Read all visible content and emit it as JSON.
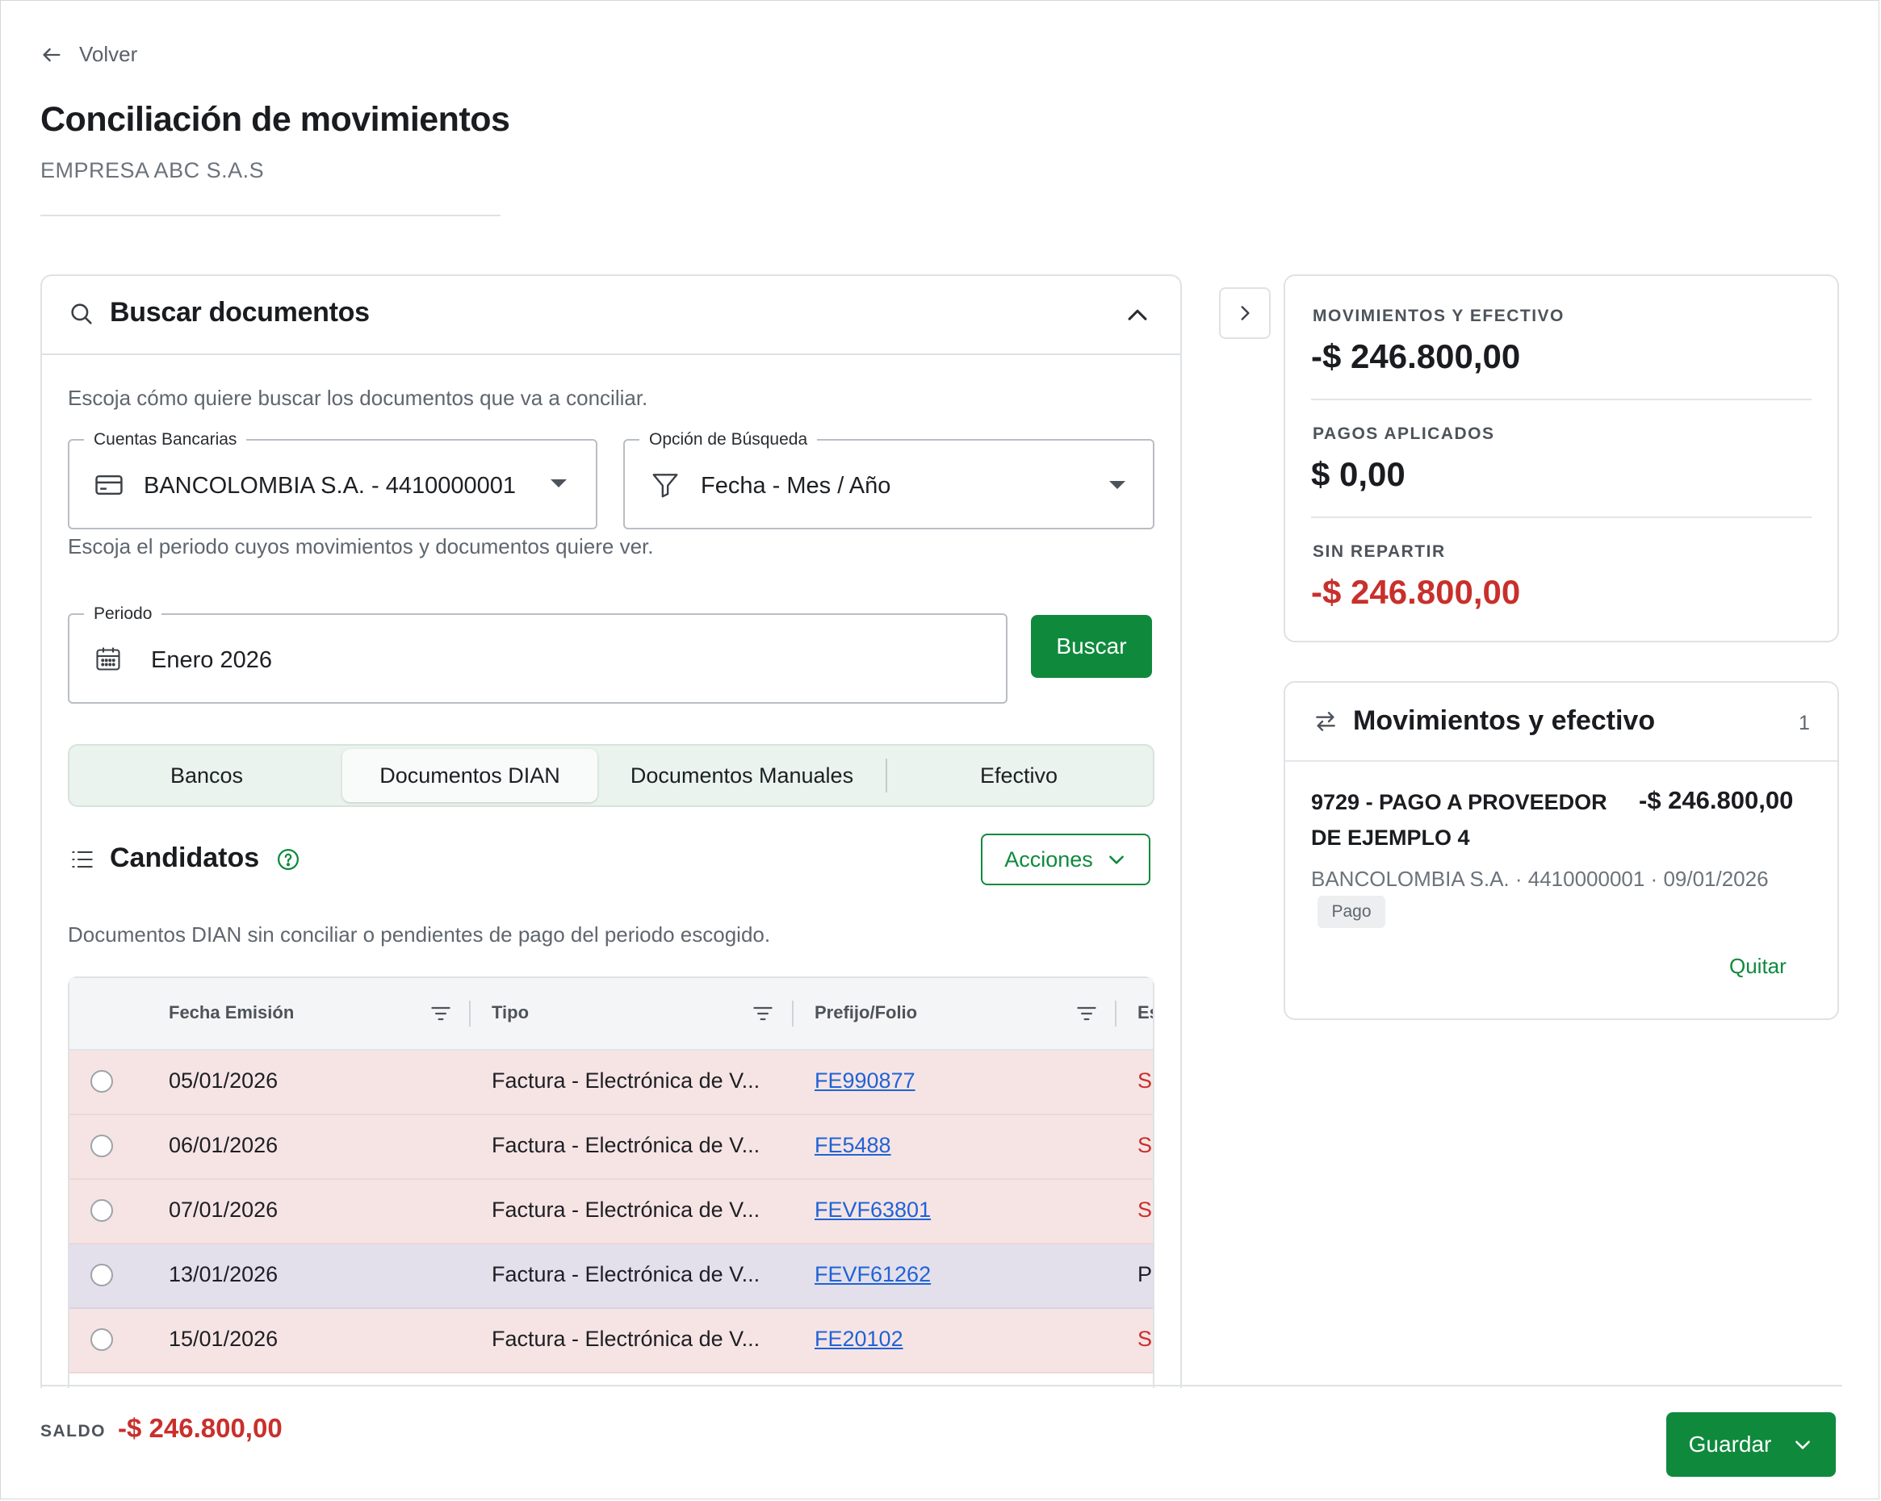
{
  "header": {
    "back_label": "Volver",
    "title": "Conciliación de movimientos",
    "subtitle": "EMPRESA ABC S.A.S"
  },
  "search": {
    "title": "Buscar documentos",
    "hint": "Escoja cómo quiere buscar los documentos que va a conciliar.",
    "bank_account": {
      "label": "Cuentas Bancarias",
      "value": "BANCOLOMBIA S.A. - 4410000001"
    },
    "search_option": {
      "label": "Opción de Búsqueda",
      "value": "Fecha - Mes / Año"
    },
    "period_hint": "Escoja el periodo cuyos movimientos y documentos quiere ver.",
    "period": {
      "label": "Periodo",
      "value": "Enero 2026"
    },
    "search_button": "Buscar"
  },
  "tabs": [
    {
      "label": "Bancos",
      "active": false
    },
    {
      "label": "Documentos DIAN",
      "active": true
    },
    {
      "label": "Documentos Manuales",
      "active": false
    },
    {
      "label": "Efectivo",
      "active": false
    }
  ],
  "candidates": {
    "title": "Candidatos",
    "actions_label": "Acciones",
    "description": "Documentos DIAN sin conciliar o pendientes de pago del periodo escogido.",
    "columns": [
      "Fecha Emisión",
      "Tipo",
      "Prefijo/Folio",
      "Es"
    ],
    "rows": [
      {
        "date": "05/01/2026",
        "type": "Factura - Electrónica de V...",
        "folio": "FE990877",
        "status": "S"
      },
      {
        "date": "06/01/2026",
        "type": "Factura - Electrónica de V...",
        "folio": "FE5488",
        "status": "S"
      },
      {
        "date": "07/01/2026",
        "type": "Factura - Electrónica de V...",
        "folio": "FEVF63801",
        "status": "S"
      },
      {
        "date": "13/01/2026",
        "type": "Factura - Electrónica de V...",
        "folio": "FEVF61262",
        "status": "P"
      },
      {
        "date": "15/01/2026",
        "type": "Factura - Electrónica de V...",
        "folio": "FE20102",
        "status": "S"
      }
    ]
  },
  "summary": {
    "movements_label": "MOVIMIENTOS Y EFECTIVO",
    "movements_value": "-$ 246.800,00",
    "applied_label": "PAGOS APLICADOS",
    "applied_value": "$ 0,00",
    "unallocated_label": "SIN REPARTIR",
    "unallocated_value": "-$ 246.800,00"
  },
  "movements": {
    "title": "Movimientos y efectivo",
    "count": "1",
    "item": {
      "name": "9729 - PAGO A PROVEEDOR DE EJEMPLO 4",
      "amount": "-$ 246.800,00",
      "meta": "BANCOLOMBIA S.A. · 4410000001 · 09/01/2026",
      "tag": "Pago",
      "remove_label": "Quitar"
    }
  },
  "footer": {
    "balance_label": "SALDO",
    "balance_value": "-$ 246.800,00",
    "save_label": "Guardar"
  },
  "colors": {
    "accent": "#0f8a3d",
    "negative": "#c8302c",
    "link": "#1f63d6",
    "row_unpaid": "#f6e4e4",
    "row_pending": "#e3dfeb"
  }
}
